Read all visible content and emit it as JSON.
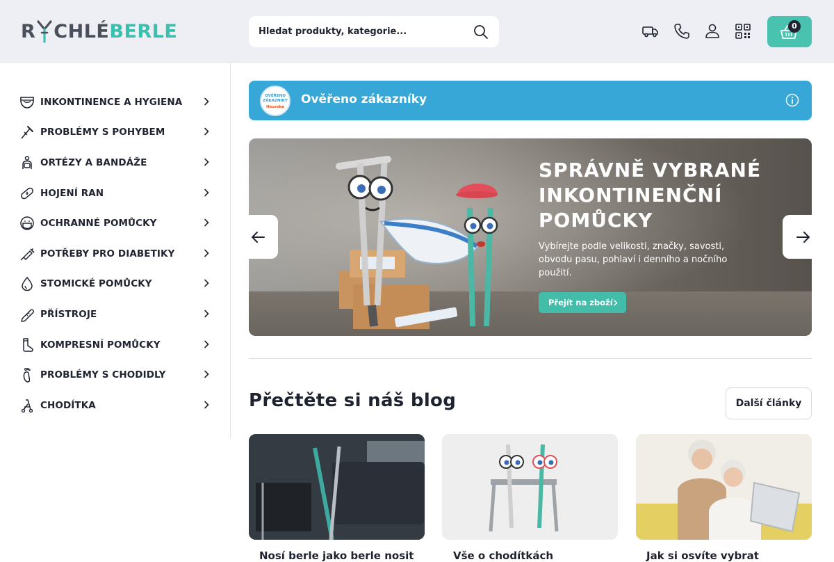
{
  "header": {
    "logo_left": "R",
    "logo_mid": "CHLÉ",
    "logo_right": "BERLE",
    "search_placeholder": "Hledat produkty, kategorie...",
    "icons": [
      "truck-icon",
      "phone-icon",
      "user-icon",
      "qr-code-icon"
    ],
    "cart_count": "0"
  },
  "sidebar": {
    "items": [
      {
        "label": "INKONTINENCE A HYGIENA",
        "icon": "diaper-icon"
      },
      {
        "label": "PROBLÉMY S POHYBEM",
        "icon": "crutch-icon"
      },
      {
        "label": "ORTÉZY A BANDÁŽE",
        "icon": "orthosis-icon"
      },
      {
        "label": "HOJENÍ RAN",
        "icon": "bandage-icon"
      },
      {
        "label": "OCHRANNÉ POMŮCKY",
        "icon": "face-mask-icon"
      },
      {
        "label": "POTŘEBY PRO DIABETIKY",
        "icon": "syringe-icon"
      },
      {
        "label": "STOMICKÉ POMŮCKY",
        "icon": "drop-icon"
      },
      {
        "label": "PŘÍSTROJE",
        "icon": "thermometer-icon"
      },
      {
        "label": "KOMPRESNÍ POMŮCKY",
        "icon": "sock-icon"
      },
      {
        "label": "PROBLÉMY S CHODIDLY",
        "icon": "foot-icon"
      },
      {
        "label": "CHODÍTKA",
        "icon": "walker-icon"
      }
    ]
  },
  "verified": {
    "text": "Ověřeno zákazníky",
    "seal_line1": "OVĚŘENO",
    "seal_line2": "ZÁKAZNÍKY",
    "seal_brand": "Heureka"
  },
  "banner": {
    "title": "SPRÁVNĚ VYBRANÉ INKONTINENČNÍ POMŮCKY",
    "description": "Vybírejte podle velikosti, značky, savosti, obvodu pasu, pohlaví i denního a nočního použití.",
    "button": "Přejít na zboží"
  },
  "blog": {
    "title": "Přečtěte si náš blog",
    "more_button": "Další články",
    "cards": [
      {
        "title": "Nosí berle jako berle nosit"
      },
      {
        "title": "Vše o chodítkách"
      },
      {
        "title": "Jak si osvíte vybrat"
      }
    ]
  },
  "colors": {
    "accent": "#49c2b0",
    "verified_bar": "#36a7d7",
    "header_bg": "#eeeff4",
    "text": "#1f2330"
  }
}
